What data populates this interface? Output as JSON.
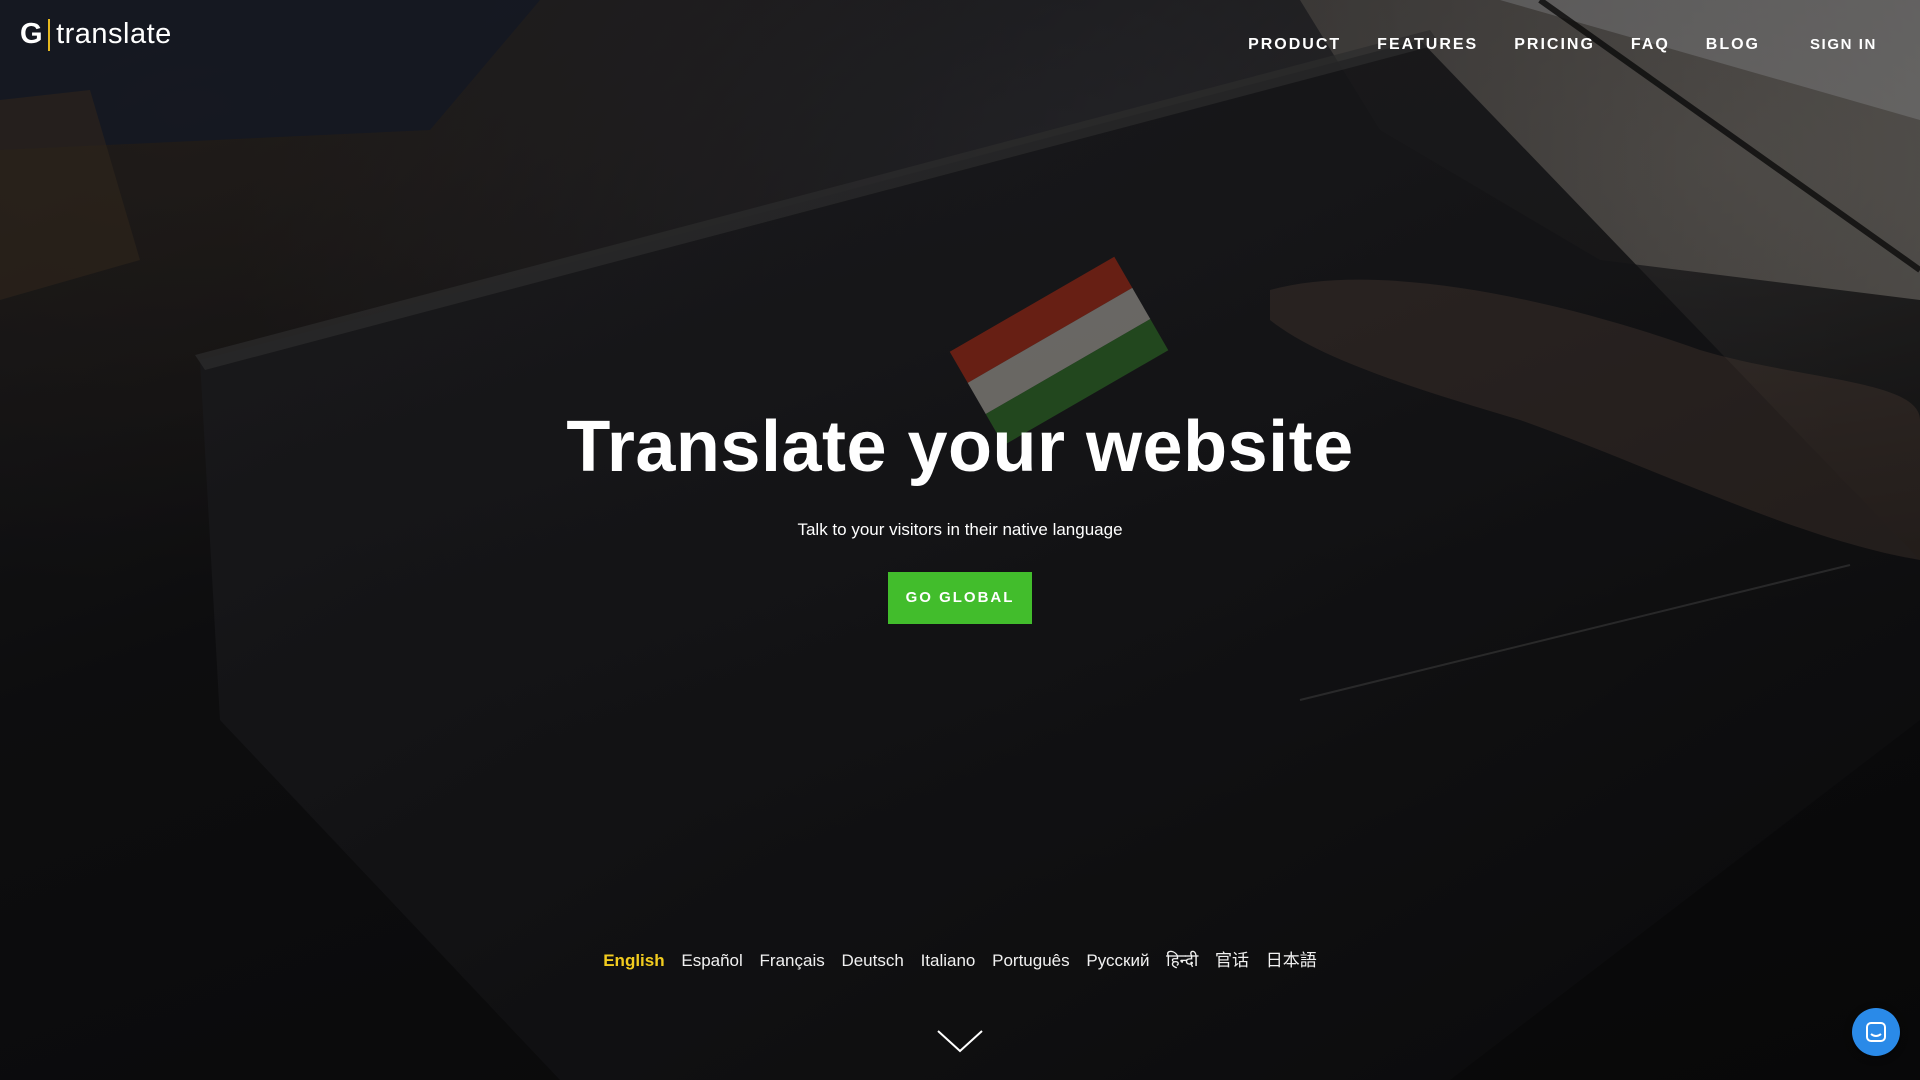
{
  "brand": {
    "logo_letter": "G",
    "logo_word": "translate",
    "accent_color": "#e6b81f"
  },
  "nav": {
    "items": [
      {
        "label": "PRODUCT"
      },
      {
        "label": "FEATURES"
      },
      {
        "label": "PRICING"
      },
      {
        "label": "FAQ"
      },
      {
        "label": "BLOG"
      }
    ],
    "signin_label": "SIGN IN"
  },
  "hero": {
    "title": "Translate your website",
    "subtitle": "Talk to your visitors in their native language",
    "cta_label": "GO GLOBAL",
    "cta_color": "#42bd2c"
  },
  "languages": {
    "active": "English",
    "active_color": "#f2cc1f",
    "items": [
      {
        "label": "English"
      },
      {
        "label": "Español"
      },
      {
        "label": "Français"
      },
      {
        "label": "Deutsch"
      },
      {
        "label": "Italiano"
      },
      {
        "label": "Português"
      },
      {
        "label": "Русский"
      },
      {
        "label": "हिन्दी"
      },
      {
        "label": "官话"
      },
      {
        "label": "日本語"
      }
    ]
  },
  "icons": {
    "scroll": "chevron-down-icon",
    "chat": "chat-icon",
    "chat_color": "#2a8ae8"
  }
}
